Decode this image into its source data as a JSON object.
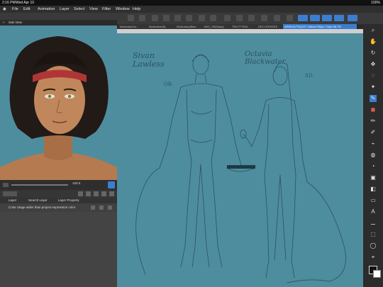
{
  "status_bar": {
    "time": "2:16 PM",
    "date": "Wed Apr 10",
    "battery": "100%"
  },
  "menu": {
    "items": [
      "File",
      "Edit",
      "Animation",
      "Layer",
      "Select",
      "View",
      "Filter",
      "Window",
      "Help"
    ]
  },
  "sub_view": {
    "tab_label": "Sub View",
    "zoom_value": "100.0"
  },
  "layer_panel": {
    "tabs": [
      "Layer",
      "Search Layer",
      "Layer Property"
    ],
    "tooltip": "Color range wider than project expression color"
  },
  "document_tabs": [
    "IllustrationSu...",
    "Illustration(B)",
    "Illustration(Blan",
    "IMG_1982(sep)",
    "TRUTTTEIB...",
    "DECCEEEEEE",
    "APRILEVTH(2/27 1964x2760px 72dpi 56.7%"
  ],
  "canvas": {
    "text_left_name": "Sivan Lawless",
    "text_left_tag": "OB.",
    "text_right_name": "Octavia Blackwater",
    "text_right_tag": "SD."
  },
  "colors": {
    "canvas_bg": "#4e8d9e",
    "accent": "#3b7ed0"
  }
}
